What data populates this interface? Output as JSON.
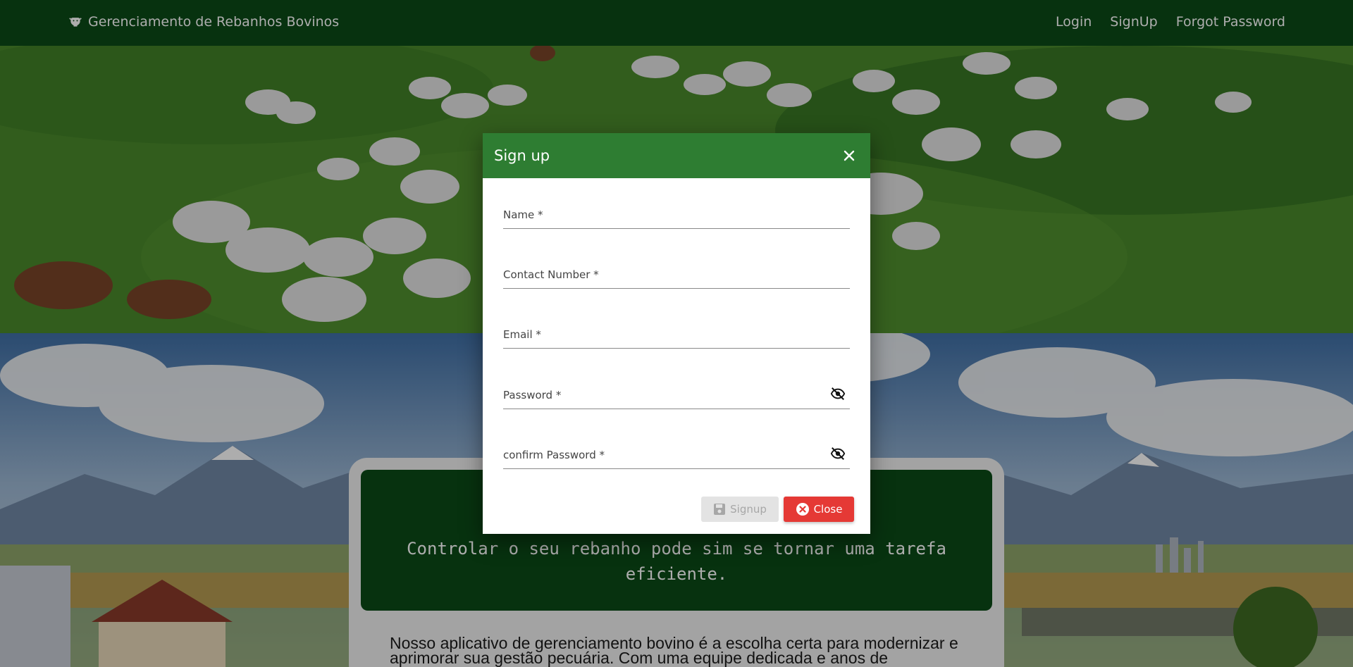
{
  "navbar": {
    "brand_title": "Gerenciamento de Rebanhos Bovinos",
    "brand_icon": "cow-icon",
    "links": [
      "Login",
      "SignUp",
      "Forgot Password"
    ]
  },
  "content": {
    "quote": "Controlar o seu rebanho pode sim se tornar uma tarefa eficiente.",
    "about": "Nosso aplicativo de gerenciamento bovino é a escolha certa para modernizar e aprimorar sua gestão pecuária. Com uma equipe dedicada e anos de"
  },
  "modal": {
    "title": "Sign up",
    "fields": [
      {
        "label": "Name *",
        "value": ""
      },
      {
        "label": "Contact Number *",
        "value": ""
      },
      {
        "label": "Email *",
        "value": ""
      },
      {
        "label": "Password *",
        "value": "",
        "icon": "visibility-off-icon"
      },
      {
        "label": "confirm Password *",
        "value": "",
        "icon": "visibility-off-icon"
      }
    ],
    "signup_label": "Signup",
    "close_label": "Close"
  },
  "colors": {
    "navbar": "#0b4a17",
    "modal_header": "#2e7d32",
    "close_button": "#e53935",
    "signup_button_disabled": "#e3e3e3"
  }
}
